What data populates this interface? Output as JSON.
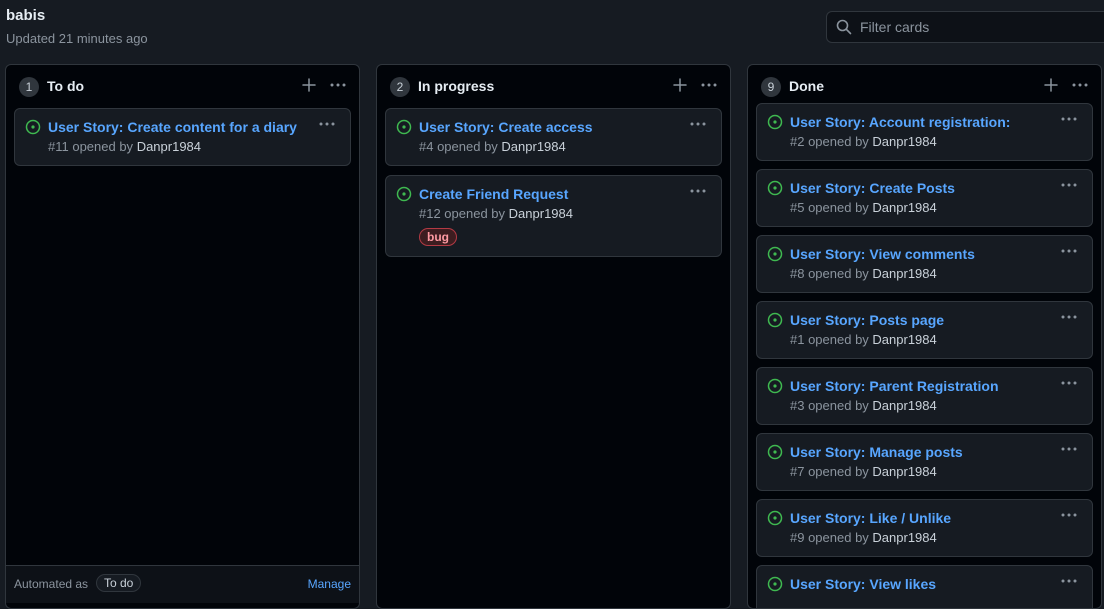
{
  "project": {
    "title": "babis",
    "updated": "Updated 21 minutes ago"
  },
  "filter": {
    "placeholder": "Filter cards"
  },
  "colors": {
    "accent": "#58a6ff",
    "open_issue": "#3fb950",
    "bug_label": "#ff9aa2"
  },
  "columns": [
    {
      "name": "To do",
      "count": "1",
      "cards": [
        {
          "title": "User Story: Create content for a diary",
          "meta": "#11 opened by",
          "author": "Danpr1984"
        }
      ],
      "footer": {
        "text": "Automated as",
        "pill": "To do",
        "manage": "Manage"
      }
    },
    {
      "name": "In progress",
      "count": "2",
      "cards": [
        {
          "title": "User Story: Create access",
          "meta": "#4 opened by",
          "author": "Danpr1984"
        },
        {
          "title": "Create Friend Request",
          "meta": "#12 opened by",
          "author": "Danpr1984",
          "label": "bug"
        }
      ]
    },
    {
      "name": "Done",
      "count": "9",
      "cards": [
        {
          "title": "User Story: Account registration:",
          "meta": "#2 opened by",
          "author": "Danpr1984"
        },
        {
          "title": "User Story: Create Posts",
          "meta": "#5 opened by",
          "author": "Danpr1984"
        },
        {
          "title": "User Story: View comments",
          "meta": "#8 opened by",
          "author": "Danpr1984"
        },
        {
          "title": "User Story: Posts page",
          "meta": "#1 opened by",
          "author": "Danpr1984"
        },
        {
          "title": "User Story: Parent Registration",
          "meta": "#3 opened by",
          "author": "Danpr1984"
        },
        {
          "title": "User Story: Manage posts",
          "meta": "#7 opened by",
          "author": "Danpr1984"
        },
        {
          "title": "User Story: Like / Unlike",
          "meta": "#9 opened by",
          "author": "Danpr1984"
        },
        {
          "title": "User Story: View likes",
          "meta": "",
          "author": ""
        }
      ]
    }
  ]
}
